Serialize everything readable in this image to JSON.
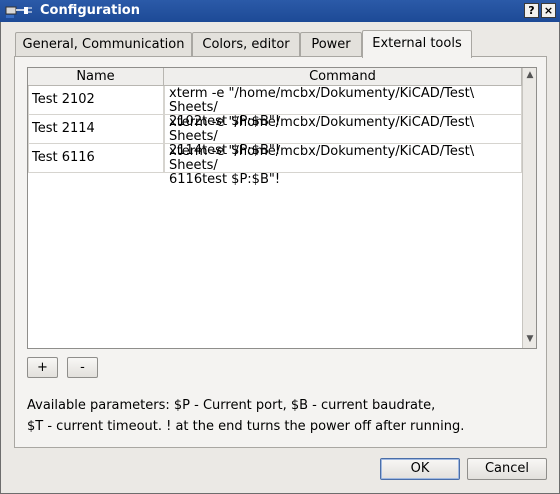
{
  "window": {
    "title": "Configuration",
    "help_label": "?",
    "close_label": "×"
  },
  "tabs": [
    {
      "label": "General, Communication"
    },
    {
      "label": "Colors, editor"
    },
    {
      "label": "Power"
    },
    {
      "label": "External tools"
    }
  ],
  "active_tab": "External tools",
  "table": {
    "columns": [
      "Name",
      "Command"
    ],
    "rows": [
      {
        "name": "Test 2102",
        "command_line1": "xterm -e \"/home/mcbx/Dokumenty/KiCAD/Test\\ Sheets/",
        "command_line2": "2102test $P:$B\"!"
      },
      {
        "name": "Test 2114",
        "command_line1": "xterm -e \"/home/mcbx/Dokumenty/KiCAD/Test\\ Sheets/",
        "command_line2": "2114test $P:$B\"!"
      },
      {
        "name": "Test 6116",
        "command_line1": "xterm -e \"/home/mcbx/Dokumenty/KiCAD/Test\\ Sheets/",
        "command_line2": "6116test $P:$B\"!"
      }
    ]
  },
  "buttons": {
    "add": "+",
    "remove": "-",
    "ok": "OK",
    "cancel": "Cancel"
  },
  "info": {
    "line1": "Available parameters: $P - Current port, $B - current baudrate,",
    "line2": "$T - current timeout. ! at the end turns the power off after running."
  },
  "colors": {
    "titlebar": "#1d4a96",
    "window_bg": "#ebe9e5"
  }
}
